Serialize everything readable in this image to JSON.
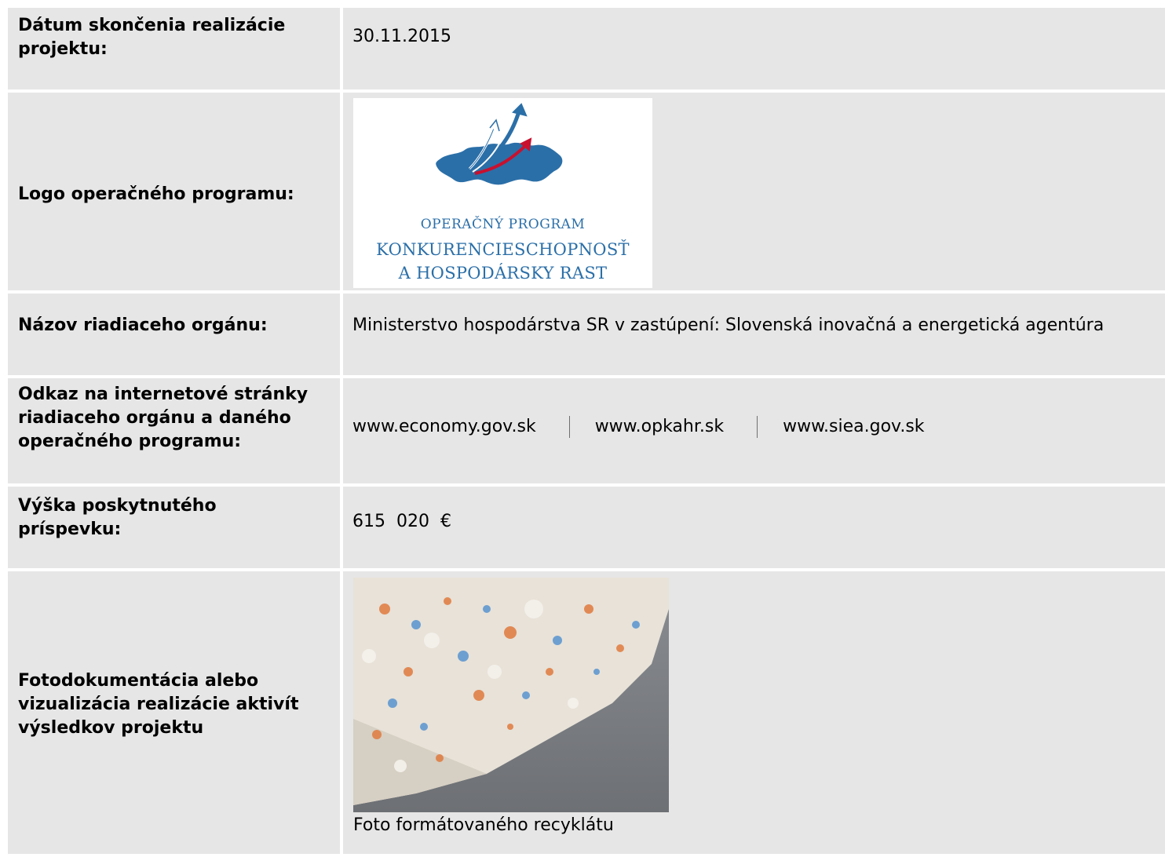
{
  "rows": {
    "end_date": {
      "label": "Dátum skončenia realizácie projektu:",
      "value": "30.11.2015"
    },
    "logo": {
      "label": "Logo operačného programu:",
      "logo_line1": "OPERAČNÝ PROGRAM",
      "logo_line2": "KONKURENCIESCHOPNOSŤ",
      "logo_line3": "A HOSPODÁRSKY RAST"
    },
    "authority": {
      "label": "Názov riadiaceho orgánu:",
      "value": "Ministerstvo hospodárstva SR v zastúpení: Slovenská inovačná a energetická agentúra"
    },
    "links": {
      "label": "Odkaz na internetové stránky riadiaceho orgánu a daného operačného programu:",
      "link1": "www.economy.gov.sk",
      "link2": "www.opkahr.sk",
      "link3": "www.siea.gov.sk"
    },
    "amount": {
      "label": "Výška poskytnutého príspevku:",
      "value": "615  020  €"
    },
    "photo": {
      "label": "Fotodokumentácia alebo vizualizácia realizácie aktivít výsledkov projektu",
      "caption": "Foto formátovaného recyklátu"
    }
  },
  "colors": {
    "cell_bg": "#e6e6e6",
    "logo_blue": "#2b6fa8",
    "logo_red": "#c8102e"
  },
  "icons": [
    "slovakia-map-icon",
    "rising-arrows-icon"
  ]
}
